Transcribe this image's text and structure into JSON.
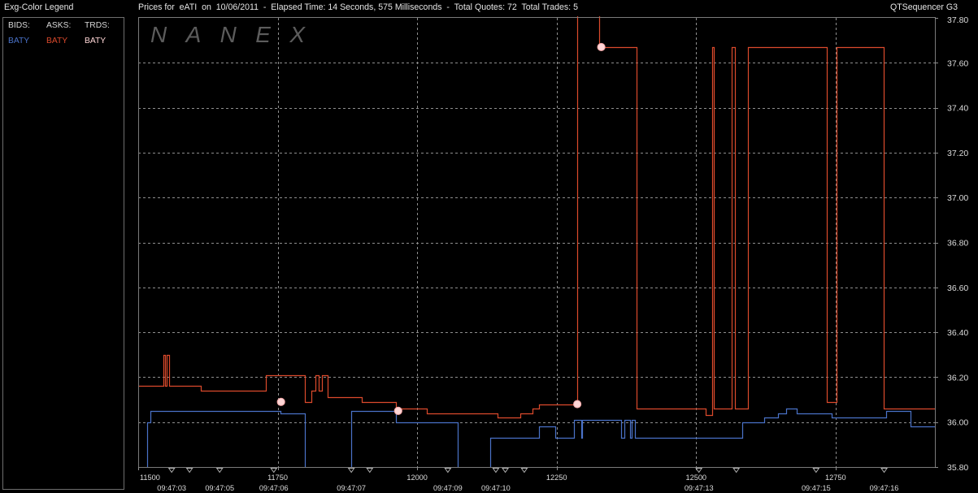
{
  "legend_panel": {
    "title": "Exg-Color Legend"
  },
  "header": {
    "product_name": "QTSequencer G3"
  },
  "watermark": "NANEX",
  "chart_data": {
    "type": "line",
    "title": "Prices for  eATI  on  10/06/2011  -  Elapsed Time: 14 Seconds, 575 Milliseconds  -  Total Quotes: 72  Total Trades: 5",
    "xlim": [
      11500,
      12928
    ],
    "ylim": [
      35.8,
      37.8
    ],
    "x_ticks": [
      11500,
      11750,
      12000,
      12250,
      12500,
      12750
    ],
    "y_ticks": [
      "37.80",
      "37.60",
      "37.40",
      "37.20",
      "37.00",
      "36.80",
      "36.60",
      "36.40",
      "36.20",
      "36.00",
      "35.80"
    ],
    "y_axis_side": "right",
    "grid": true,
    "grid_style": "dashed",
    "legend_placement": "left-panel",
    "series": [
      {
        "name": "BIDS:",
        "exchange": "BATY",
        "color": "#4a72c8",
        "style": "step",
        "points": [
          [
            11500,
            null
          ],
          [
            11516,
            36.0
          ],
          [
            11522,
            36.05
          ],
          [
            11755,
            36.04
          ],
          [
            11799,
            null
          ],
          [
            11882,
            36.05
          ],
          [
            11962,
            36.0
          ],
          [
            12073,
            null
          ],
          [
            12131,
            35.93
          ],
          [
            12218,
            35.98
          ],
          [
            12247,
            35.93
          ],
          [
            12281,
            36.01
          ],
          [
            12294,
            35.93
          ],
          [
            12296,
            36.01
          ],
          [
            12365,
            35.93
          ],
          [
            12372,
            36.01
          ],
          [
            12381,
            35.93
          ],
          [
            12385,
            36.01
          ],
          [
            12390,
            35.93
          ],
          [
            12582,
            36.0
          ],
          [
            12622,
            36.02
          ],
          [
            12647,
            36.04
          ],
          [
            12661,
            36.06
          ],
          [
            12680,
            36.04
          ],
          [
            12743,
            36.02
          ],
          [
            12840,
            36.05
          ],
          [
            12884,
            35.98
          ]
        ]
      },
      {
        "name": "ASKS:",
        "exchange": "BATY",
        "color": "#dc4a2c",
        "style": "step",
        "points": [
          [
            11500,
            36.16
          ],
          [
            11545,
            36.3
          ],
          [
            11548,
            36.16
          ],
          [
            11551,
            36.3
          ],
          [
            11555,
            36.16
          ],
          [
            11612,
            36.14
          ],
          [
            11729,
            36.21
          ],
          [
            11799,
            36.09
          ],
          [
            11810,
            36.14
          ],
          [
            11818,
            36.21
          ],
          [
            11823,
            36.14
          ],
          [
            11829,
            36.21
          ],
          [
            11839,
            36.11
          ],
          [
            11901,
            36.09
          ],
          [
            11962,
            36.06
          ],
          [
            12017,
            36.04
          ],
          [
            12144,
            36.02
          ],
          [
            12185,
            36.04
          ],
          [
            12207,
            36.06
          ],
          [
            12218,
            36.08
          ],
          [
            12287,
            null
          ],
          [
            12326,
            37.67
          ],
          [
            12393,
            36.06
          ],
          [
            12517,
            36.03
          ],
          [
            12529,
            37.67
          ],
          [
            12531,
            36.06
          ],
          [
            12564,
            37.67
          ],
          [
            12569,
            36.06
          ],
          [
            12593,
            37.67
          ],
          [
            12734,
            36.09
          ],
          [
            12751,
            37.67
          ],
          [
            12836,
            36.06
          ]
        ]
      },
      {
        "name": "TRDS:",
        "exchange": "BATY",
        "color": "#ffd6d6",
        "style": "points",
        "points": [
          [
            11756,
            36.09
          ],
          [
            11966,
            36.05
          ],
          [
            12287,
            36.08
          ],
          [
            12330,
            37.67
          ]
        ]
      }
    ],
    "time_markers": [
      11560,
      11592,
      11646,
      11743,
      11882,
      11915,
      12055,
      12141,
      12158,
      12192,
      12505,
      12572,
      12715,
      12837
    ],
    "time_labels": [
      {
        "x": 11560,
        "label": "09:47:03"
      },
      {
        "x": 11646,
        "label": "09:47:05"
      },
      {
        "x": 11743,
        "label": "09:47:06"
      },
      {
        "x": 11882,
        "label": "09:47:07"
      },
      {
        "x": 12055,
        "label": "09:47:09"
      },
      {
        "x": 12141,
        "label": "09:47:10"
      },
      {
        "x": 12505,
        "label": "09:47:13"
      },
      {
        "x": 12715,
        "label": "09:47:15"
      },
      {
        "x": 12837,
        "label": "09:47:16"
      }
    ]
  }
}
